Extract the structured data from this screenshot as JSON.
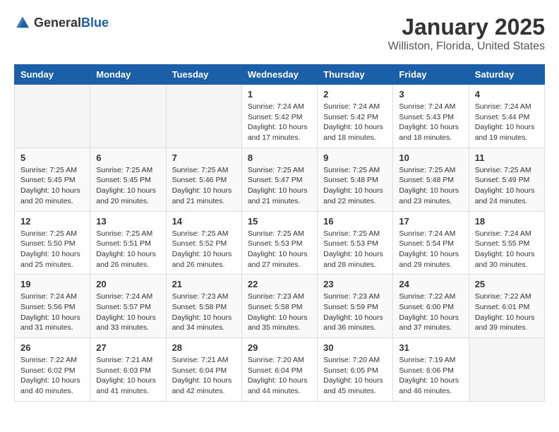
{
  "header": {
    "logo_general": "General",
    "logo_blue": "Blue",
    "month_title": "January 2025",
    "subtitle": "Williston, Florida, United States"
  },
  "days_of_week": [
    "Sunday",
    "Monday",
    "Tuesday",
    "Wednesday",
    "Thursday",
    "Friday",
    "Saturday"
  ],
  "weeks": [
    [
      {
        "day": "",
        "info": ""
      },
      {
        "day": "",
        "info": ""
      },
      {
        "day": "",
        "info": ""
      },
      {
        "day": "1",
        "info": "Sunrise: 7:24 AM\nSunset: 5:42 PM\nDaylight: 10 hours\nand 17 minutes."
      },
      {
        "day": "2",
        "info": "Sunrise: 7:24 AM\nSunset: 5:42 PM\nDaylight: 10 hours\nand 18 minutes."
      },
      {
        "day": "3",
        "info": "Sunrise: 7:24 AM\nSunset: 5:43 PM\nDaylight: 10 hours\nand 18 minutes."
      },
      {
        "day": "4",
        "info": "Sunrise: 7:24 AM\nSunset: 5:44 PM\nDaylight: 10 hours\nand 19 minutes."
      }
    ],
    [
      {
        "day": "5",
        "info": "Sunrise: 7:25 AM\nSunset: 5:45 PM\nDaylight: 10 hours\nand 20 minutes."
      },
      {
        "day": "6",
        "info": "Sunrise: 7:25 AM\nSunset: 5:45 PM\nDaylight: 10 hours\nand 20 minutes."
      },
      {
        "day": "7",
        "info": "Sunrise: 7:25 AM\nSunset: 5:46 PM\nDaylight: 10 hours\nand 21 minutes."
      },
      {
        "day": "8",
        "info": "Sunrise: 7:25 AM\nSunset: 5:47 PM\nDaylight: 10 hours\nand 21 minutes."
      },
      {
        "day": "9",
        "info": "Sunrise: 7:25 AM\nSunset: 5:48 PM\nDaylight: 10 hours\nand 22 minutes."
      },
      {
        "day": "10",
        "info": "Sunrise: 7:25 AM\nSunset: 5:48 PM\nDaylight: 10 hours\nand 23 minutes."
      },
      {
        "day": "11",
        "info": "Sunrise: 7:25 AM\nSunset: 5:49 PM\nDaylight: 10 hours\nand 24 minutes."
      }
    ],
    [
      {
        "day": "12",
        "info": "Sunrise: 7:25 AM\nSunset: 5:50 PM\nDaylight: 10 hours\nand 25 minutes."
      },
      {
        "day": "13",
        "info": "Sunrise: 7:25 AM\nSunset: 5:51 PM\nDaylight: 10 hours\nand 26 minutes."
      },
      {
        "day": "14",
        "info": "Sunrise: 7:25 AM\nSunset: 5:52 PM\nDaylight: 10 hours\nand 26 minutes."
      },
      {
        "day": "15",
        "info": "Sunrise: 7:25 AM\nSunset: 5:53 PM\nDaylight: 10 hours\nand 27 minutes."
      },
      {
        "day": "16",
        "info": "Sunrise: 7:25 AM\nSunset: 5:53 PM\nDaylight: 10 hours\nand 28 minutes."
      },
      {
        "day": "17",
        "info": "Sunrise: 7:24 AM\nSunset: 5:54 PM\nDaylight: 10 hours\nand 29 minutes."
      },
      {
        "day": "18",
        "info": "Sunrise: 7:24 AM\nSunset: 5:55 PM\nDaylight: 10 hours\nand 30 minutes."
      }
    ],
    [
      {
        "day": "19",
        "info": "Sunrise: 7:24 AM\nSunset: 5:56 PM\nDaylight: 10 hours\nand 31 minutes."
      },
      {
        "day": "20",
        "info": "Sunrise: 7:24 AM\nSunset: 5:57 PM\nDaylight: 10 hours\nand 33 minutes."
      },
      {
        "day": "21",
        "info": "Sunrise: 7:23 AM\nSunset: 5:58 PM\nDaylight: 10 hours\nand 34 minutes."
      },
      {
        "day": "22",
        "info": "Sunrise: 7:23 AM\nSunset: 5:58 PM\nDaylight: 10 hours\nand 35 minutes."
      },
      {
        "day": "23",
        "info": "Sunrise: 7:23 AM\nSunset: 5:59 PM\nDaylight: 10 hours\nand 36 minutes."
      },
      {
        "day": "24",
        "info": "Sunrise: 7:22 AM\nSunset: 6:00 PM\nDaylight: 10 hours\nand 37 minutes."
      },
      {
        "day": "25",
        "info": "Sunrise: 7:22 AM\nSunset: 6:01 PM\nDaylight: 10 hours\nand 39 minutes."
      }
    ],
    [
      {
        "day": "26",
        "info": "Sunrise: 7:22 AM\nSunset: 6:02 PM\nDaylight: 10 hours\nand 40 minutes."
      },
      {
        "day": "27",
        "info": "Sunrise: 7:21 AM\nSunset: 6:03 PM\nDaylight: 10 hours\nand 41 minutes."
      },
      {
        "day": "28",
        "info": "Sunrise: 7:21 AM\nSunset: 6:04 PM\nDaylight: 10 hours\nand 42 minutes."
      },
      {
        "day": "29",
        "info": "Sunrise: 7:20 AM\nSunset: 6:04 PM\nDaylight: 10 hours\nand 44 minutes."
      },
      {
        "day": "30",
        "info": "Sunrise: 7:20 AM\nSunset: 6:05 PM\nDaylight: 10 hours\nand 45 minutes."
      },
      {
        "day": "31",
        "info": "Sunrise: 7:19 AM\nSunset: 6:06 PM\nDaylight: 10 hours\nand 46 minutes."
      },
      {
        "day": "",
        "info": ""
      }
    ]
  ]
}
